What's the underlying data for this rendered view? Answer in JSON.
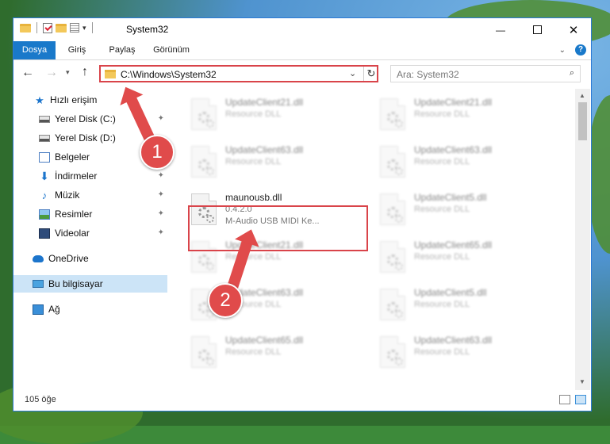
{
  "window": {
    "title": "System32",
    "minimize": "—",
    "close": "✕"
  },
  "ribbon": {
    "tabs": [
      "Dosya",
      "Giriş",
      "Paylaş",
      "Görünüm"
    ],
    "expand": "⌄",
    "help": "?"
  },
  "nav": {
    "back": "←",
    "forward": "→",
    "recent": "▾",
    "up": "↑",
    "address": "C:\\Windows\\System32",
    "address_dropdown": "⌄",
    "refresh": "↻",
    "search_placeholder": "Ara: System32",
    "search_icon": "⌕"
  },
  "sidebar": {
    "items": [
      {
        "label": "Hızlı erişim",
        "icon": "star-icon"
      },
      {
        "label": "Yerel Disk (C:)",
        "icon": "drive-icon",
        "pinned": true
      },
      {
        "label": "Yerel Disk (D:)",
        "icon": "drive-icon",
        "pinned": false
      },
      {
        "label": "Belgeler",
        "icon": "documents-icon",
        "pinned": false
      },
      {
        "label": "İndirmeler",
        "icon": "download-icon",
        "pinned": true
      },
      {
        "label": "Müzik",
        "icon": "music-icon",
        "pinned": true
      },
      {
        "label": "Resimler",
        "icon": "pictures-icon",
        "pinned": true
      },
      {
        "label": "Videolar",
        "icon": "videos-icon",
        "pinned": true
      },
      {
        "label": "OneDrive",
        "icon": "onedrive-icon"
      },
      {
        "label": "Bu bilgisayar",
        "icon": "computer-icon",
        "selected": true
      },
      {
        "label": "Ağ",
        "icon": "network-icon"
      }
    ],
    "pin_glyph": "📌"
  },
  "files": [
    {
      "name": "UpdateClient21.dll",
      "desc": "Resource DLL",
      "blurred": true
    },
    {
      "name": "UpdateClient21.dll",
      "desc": "Resource DLL",
      "blurred": true
    },
    {
      "name": "UpdateClient63.dll",
      "desc": "Resource DLL",
      "blurred": true
    },
    {
      "name": "UpdateClient63.dll",
      "desc": "Resource DLL",
      "blurred": true
    },
    {
      "name": "maunousb.dll",
      "version": "0.4.2.0",
      "desc": "M-Audio USB MIDI Ke...",
      "blurred": false,
      "highlighted": true
    },
    {
      "name": "UpdateClient5.dll",
      "desc": "Resource DLL",
      "blurred": true
    },
    {
      "name": "UpdateClient21.dll",
      "desc": "Resource DLL",
      "blurred": true
    },
    {
      "name": "UpdateClient65.dll",
      "desc": "Resource DLL",
      "blurred": true
    },
    {
      "name": "UpdateClient63.dll",
      "desc": "Resource DLL",
      "blurred": true
    },
    {
      "name": "UpdateClient5.dll",
      "desc": "Resource DLL",
      "blurred": true
    },
    {
      "name": "UpdateClient65.dll",
      "desc": "Resource DLL",
      "blurred": true
    },
    {
      "name": "UpdateClient63.dll",
      "desc": "Resource DLL",
      "blurred": true
    }
  ],
  "status": {
    "count": "105 öğe"
  },
  "annotations": {
    "step1": "1",
    "step2": "2",
    "color": "#e04b4b"
  },
  "colors": {
    "accent": "#1979ca",
    "selection": "#cce4f7",
    "highlight_border": "#d9444a"
  }
}
